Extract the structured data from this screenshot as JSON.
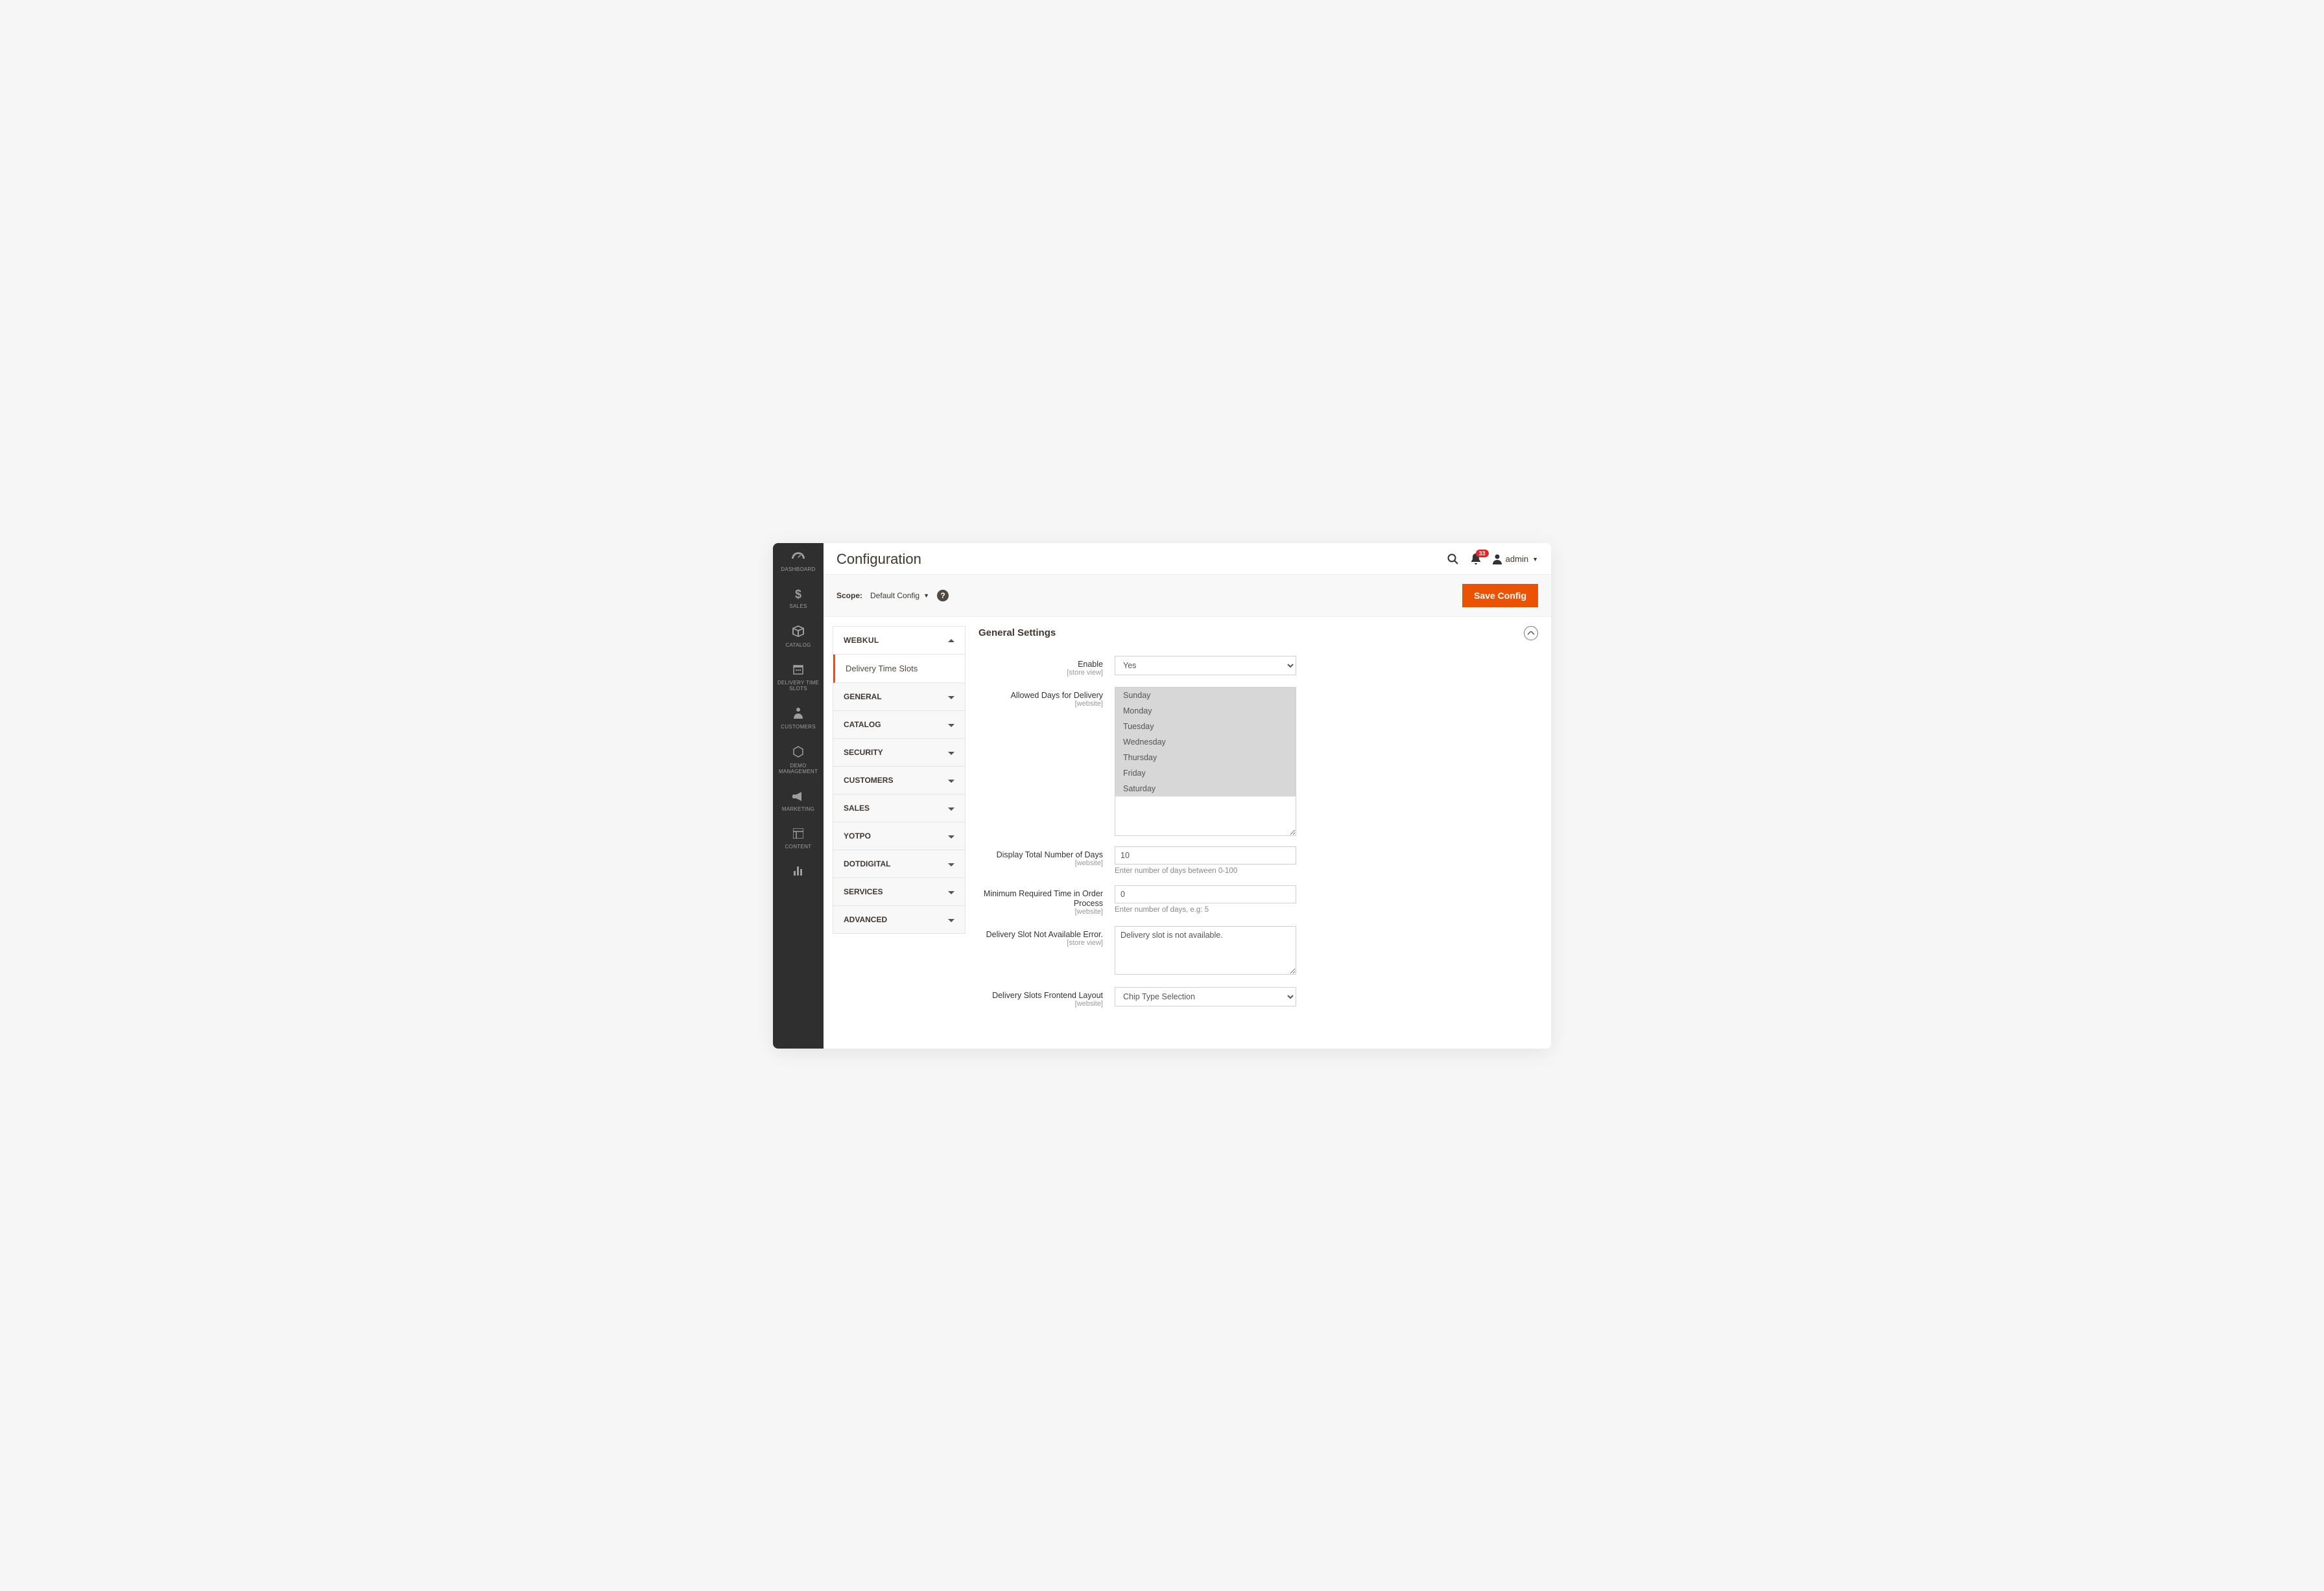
{
  "sidebar": {
    "items": [
      {
        "label": "DASHBOARD"
      },
      {
        "label": "SALES"
      },
      {
        "label": "CATALOG"
      },
      {
        "label": "DELIVERY TIME SLOTS"
      },
      {
        "label": "CUSTOMERS"
      },
      {
        "label": "DEMO MANAGEMENT"
      },
      {
        "label": "MARKETING"
      },
      {
        "label": "CONTENT"
      },
      {
        "label": ""
      }
    ]
  },
  "header": {
    "title": "Configuration",
    "notif_count": "33",
    "user": "admin"
  },
  "scope": {
    "label": "Scope:",
    "value": "Default Config",
    "save": "Save Config"
  },
  "tabs": {
    "open_group": "WEBKUL",
    "open_item": "Delivery Time Slots",
    "groups": [
      "GENERAL",
      "CATALOG",
      "SECURITY",
      "CUSTOMERS",
      "SALES",
      "YOTPO",
      "DOTDIGITAL",
      "SERVICES",
      "ADVANCED"
    ]
  },
  "section": {
    "title": "General Settings"
  },
  "fields": {
    "enable": {
      "label": "Enable",
      "scope": "[store view]",
      "value": "Yes"
    },
    "allowed_days": {
      "label": "Allowed Days for Delivery",
      "scope": "[website]",
      "options": [
        "Sunday",
        "Monday",
        "Tuesday",
        "Wednesday",
        "Thursday",
        "Friday",
        "Saturday"
      ]
    },
    "total_days": {
      "label": "Display Total Number of Days",
      "scope": "[website]",
      "value": "10",
      "hint": "Enter number of days between 0-100"
    },
    "min_time": {
      "label": "Minimum Required Time in Order Process",
      "scope": "[website]",
      "value": "0",
      "hint": "Enter number of days, e.g: 5"
    },
    "na_error": {
      "label": "Delivery Slot Not Available Error.",
      "scope": "[store view]",
      "value": "Delivery slot is not available."
    },
    "layout": {
      "label": "Delivery Slots Frontend Layout",
      "scope": "[website]",
      "value": "Chip Type Selection"
    }
  }
}
